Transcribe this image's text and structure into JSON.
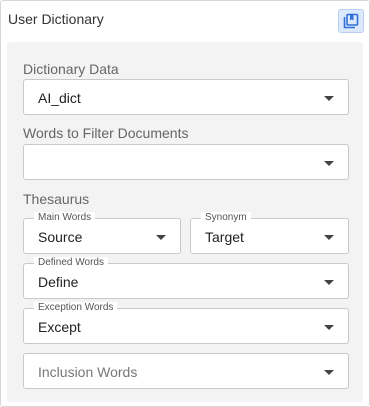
{
  "header": {
    "title": "User Dictionary",
    "save_icon": "save-icon"
  },
  "dictionary_data": {
    "label": "Dictionary Data",
    "value": "AI_dict"
  },
  "filter_documents": {
    "label": "Words to Filter Documents",
    "value": ""
  },
  "thesaurus": {
    "label": "Thesaurus",
    "main_words": {
      "label": "Main Words",
      "value": "Source"
    },
    "synonym": {
      "label": "Synonym",
      "value": "Target"
    },
    "defined_words": {
      "label": "Defined Words",
      "value": "Define"
    },
    "exception_words": {
      "label": "Exception Words",
      "value": "Except"
    },
    "inclusion_words": {
      "placeholder": "Inclusion Words"
    }
  },
  "colors": {
    "accent": "#2f6fd6",
    "button_bg": "#dce8fb",
    "panel_bg": "#f3f3f3"
  }
}
